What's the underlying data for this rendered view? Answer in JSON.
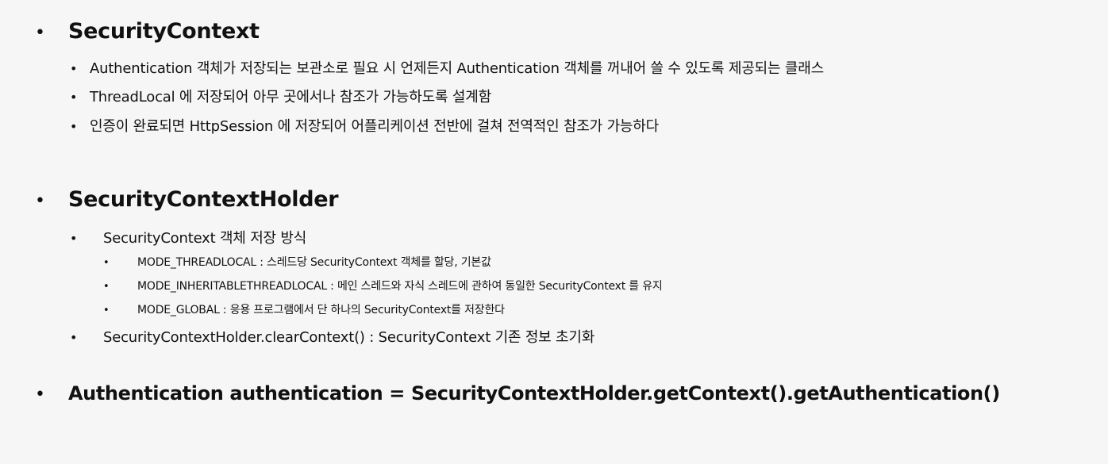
{
  "bullet": "•",
  "sections": [
    {
      "title": "SecurityContext",
      "items": [
        "Authentication 객체가 저장되는 보관소로 필요 시 언제든지 Authentication 객체를 꺼내어 쓸 수 있도록 제공되는 클래스",
        "ThreadLocal 에 저장되어 아무 곳에서나 참조가 가능하도록 설계함",
        "인증이 완료되면 HttpSession 에 저장되어 어플리케이션 전반에 걸쳐 전역적인 참조가 가능하다"
      ]
    },
    {
      "title": "SecurityContextHolder",
      "items": [
        {
          "text": "SecurityContext 객체 저장 방식",
          "subitems": [
            "MODE_THREADLOCAL : 스레드당 SecurityContext 객체를 할당, 기본값",
            "MODE_INHERITABLETHREADLOCAL : 메인 스레드와 자식 스레드에 관하여 동일한 SecurityContext 를 유지",
            "MODE_GLOBAL :  응용 프로그램에서 단 하나의 SecurityContext를 저장한다"
          ]
        },
        {
          "text": "SecurityContextHolder.clearContext() : SecurityContext 기존 정보 초기화"
        }
      ]
    },
    {
      "title": "Authentication authentication = SecurityContextHolder.getContext().getAuthentication()"
    }
  ]
}
